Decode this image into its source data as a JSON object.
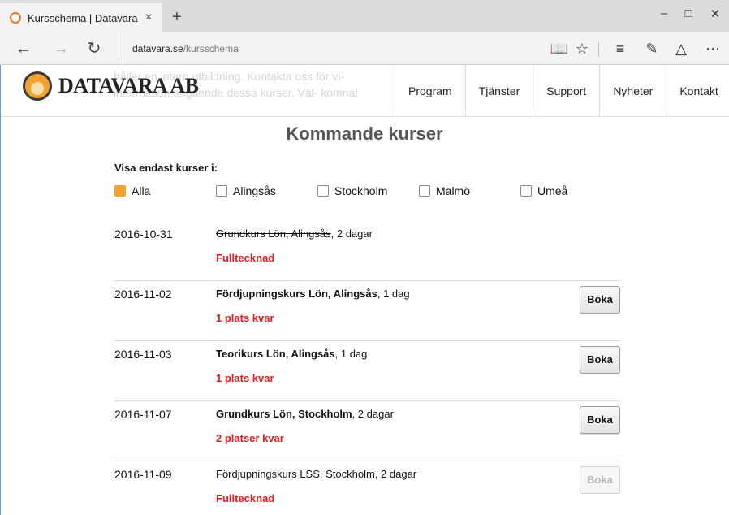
{
  "browser": {
    "tab_title": "Kursschema | Datavara",
    "tab_close": "×",
    "new_tab": "+",
    "url_host": "datavara.se",
    "url_path": "/kursschema",
    "icons": [
      "back-icon",
      "forward-icon",
      "refresh-icon",
      "reading-view-icon",
      "favorite-star-icon",
      "hub-icon",
      "web-note-icon",
      "share-icon",
      "more-icon"
    ]
  },
  "site": {
    "logo_text": "DATAVARA AB",
    "background_text": "håller en intern utbildning. Kontakta oss för vi- information angående dessa kurser. Väl- komna!",
    "nav": [
      "Program",
      "Tjänster",
      "Support",
      "Nyheter",
      "Kontakt"
    ]
  },
  "main": {
    "title": "Kommande kurser",
    "filter_label": "Visa endast kurser i:",
    "filters": [
      {
        "label": "Alla",
        "checked": true
      },
      {
        "label": "Alingsås",
        "checked": false
      },
      {
        "label": "Stockholm",
        "checked": false
      },
      {
        "label": "Malmö",
        "checked": false
      },
      {
        "label": "Umeå",
        "checked": false
      }
    ],
    "book_label": "Boka",
    "courses": [
      {
        "date": "2016-10-31",
        "name": "Grundkurs Lön, Alingsås",
        "duration": ", 2 dagar",
        "status": "Fulltecknad",
        "full": true,
        "has_button": false
      },
      {
        "date": "2016-11-02",
        "name": "Fördjupningskurs Lön, Alingsås",
        "duration": ", 1 dag",
        "status": "1 plats kvar",
        "full": false,
        "has_button": true
      },
      {
        "date": "2016-11-03",
        "name": "Teorikurs Lön, Alingsås",
        "duration": ", 1 dag",
        "status": "1 plats kvar",
        "full": false,
        "has_button": true
      },
      {
        "date": "2016-11-07",
        "name": "Grundkurs Lön, Stockholm",
        "duration": ", 2 dagar",
        "status": "2 platser kvar",
        "full": false,
        "has_button": true
      },
      {
        "date": "2016-11-09",
        "name": "Fördjupningskurs LSS, Stockholm",
        "duration": ", 2 dagar",
        "status": "Fulltecknad",
        "full": true,
        "has_button": true
      }
    ]
  },
  "colors": {
    "accent": "#f2a233",
    "status_red": "#e21c1c",
    "title_gray": "#555555"
  }
}
